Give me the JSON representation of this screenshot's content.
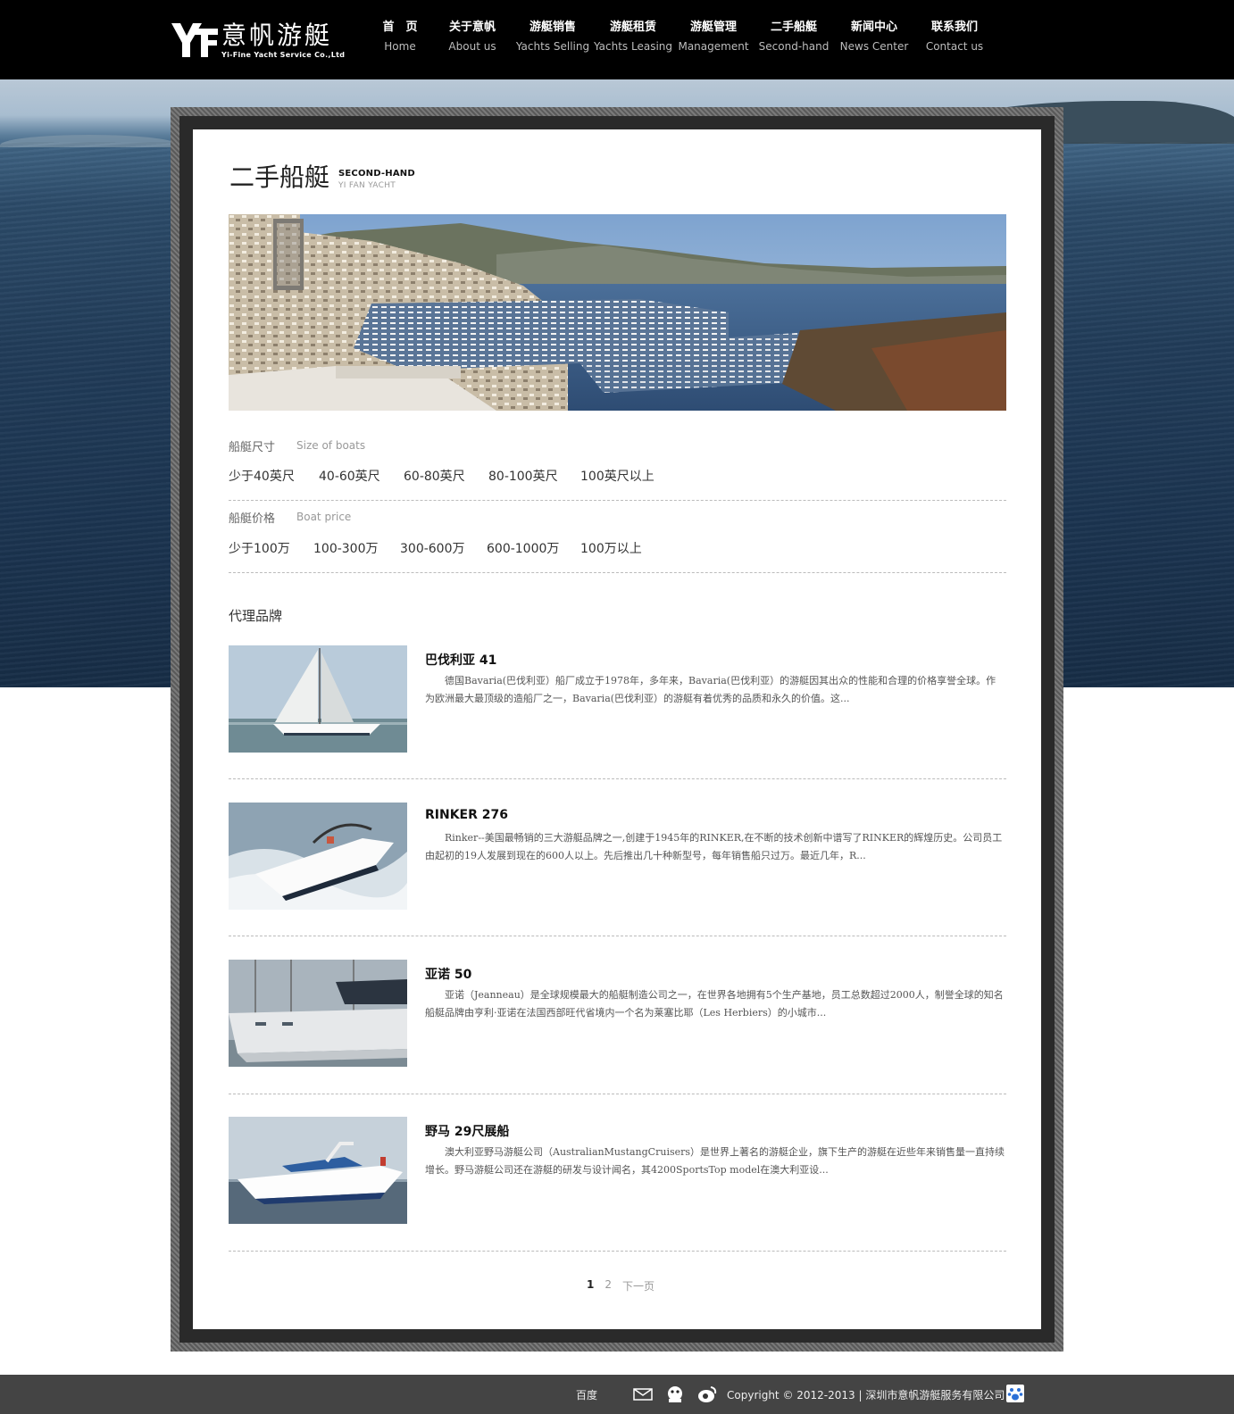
{
  "logo": {
    "cn": "意帆游艇",
    "en": "Yi-Fine Yacht Service Co.,Ltd",
    "icon": "yf-logo-mark"
  },
  "nav": [
    {
      "cn": "首　页",
      "en": "Home"
    },
    {
      "cn": "关于意帆",
      "en": "About us"
    },
    {
      "cn": "游艇销售",
      "en": "Yachts Selling"
    },
    {
      "cn": "游艇租赁",
      "en": "Yachts Leasing"
    },
    {
      "cn": "游艇管理",
      "en": "Management"
    },
    {
      "cn": "二手船艇",
      "en": "Second-hand"
    },
    {
      "cn": "新闻中心",
      "en": "News Center"
    },
    {
      "cn": "联系我们",
      "en": "Contact us"
    }
  ],
  "page_title": {
    "cn": "二手船艇",
    "en1": "SECOND-HAND",
    "en2": "YI FAN YACHT"
  },
  "filters": {
    "size": {
      "label": "船艇尺寸",
      "sub": "Size of boats",
      "options": [
        "少于40英尺",
        "40-60英尺",
        "60-80英尺",
        "80-100英尺",
        "100英尺以上"
      ]
    },
    "price": {
      "label": "船艇价格",
      "sub": "Boat price",
      "options": [
        "少于100万",
        "100-300万",
        "300-600万",
        "600-1000万",
        "100万以上"
      ]
    }
  },
  "brands": {
    "heading": "代理品牌",
    "items": [
      {
        "title": "巴伐利亚 41",
        "desc": "德国Bavaria(巴伐利亚）船厂成立于1978年，多年来，Bavaria(巴伐利亚）的游艇因其出众的性能和合理的价格享誉全球。作为欧洲最大最顶级的造船厂之一，Bavaria(巴伐利亚）的游艇有着优秀的品质和永久的价值。这..."
      },
      {
        "title": "RINKER 276",
        "desc": "Rinker--美国最畅销的三大游艇品牌之一,创建于1945年的RINKER,在不断的技术创新中谱写了RINKER的辉煌历史。公司员工由起初的19人发展到现在的600人以上。先后推出几十种新型号，每年销售船只过万。最近几年，R..."
      },
      {
        "title": "亚诺 50",
        "desc": "亚诺（Jeanneau）是全球规模最大的船艇制造公司之一，在世界各地拥有5个生产基地，员工总数超过2000人，制誉全球的知名船艇品牌由亨利·亚诺在法国西部旺代省境内一个名为莱塞比耶（Les Herbiers）的小城市..."
      },
      {
        "title": "野马 29尺展船",
        "desc": "澳大利亚野马游艇公司（AustralianMustangCruisers）是世界上著名的游艇企业，旗下生产的游艇在近些年来销售量一直持续增长。野马游艇公司还在游艇的研发与设计闻名，其4200SportsTop model在澳大利亚设..."
      }
    ]
  },
  "pager": {
    "pages": [
      "1",
      "2"
    ],
    "next": "下一页",
    "current": "1"
  },
  "footer": {
    "baidu": "百度",
    "icons": [
      "mail-icon",
      "qq-icon",
      "weibo-icon"
    ],
    "copyright": "Copyright © 2012-2013 | 深圳市意帆游艇服务有限公司",
    "paw_icon": "baidu-paw-icon"
  }
}
